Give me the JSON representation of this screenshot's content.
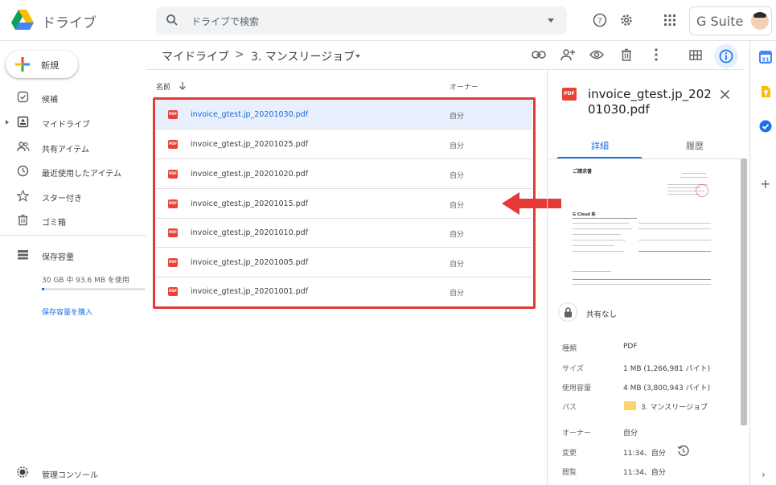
{
  "header": {
    "app_title": "ドライブ",
    "search_placeholder": "ドライブで検索",
    "gsuite_label": "G Suite"
  },
  "sidebar": {
    "new_label": "新規",
    "items": [
      {
        "label": "候補",
        "icon": "checkbox-icon"
      },
      {
        "label": "マイドライブ",
        "icon": "my-drive-icon"
      },
      {
        "label": "共有アイテム",
        "icon": "shared-icon"
      },
      {
        "label": "最近使用したアイテム",
        "icon": "clock-icon"
      },
      {
        "label": "スター付き",
        "icon": "star-icon"
      },
      {
        "label": "ゴミ箱",
        "icon": "trash-icon"
      }
    ],
    "storage": {
      "label": "保存容量",
      "usage": "30 GB 中 93.6 MB を使用",
      "fraction": 0.003,
      "buy_label": "保存容量を購入"
    },
    "admin_label": "管理コンソール"
  },
  "breadcrumb": {
    "root": "マイドライブ",
    "separator": ">",
    "current": "3. マンスリージョブ"
  },
  "file_list": {
    "col_name": "名前",
    "col_owner": "オーナー",
    "files": [
      {
        "name": "invoice_gtest.jp_20201030.pdf",
        "owner": "自分",
        "icon_text": "PDF"
      },
      {
        "name": "invoice_gtest.jp_20201025.pdf",
        "owner": "自分",
        "icon_text": "PDF"
      },
      {
        "name": "invoice_gtest.jp_20201020.pdf",
        "owner": "自分",
        "icon_text": "PDF"
      },
      {
        "name": "invoice_gtest.jp_20201015.pdf",
        "owner": "自分",
        "icon_text": "PDF"
      },
      {
        "name": "invoice_gtest.jp_20201010.pdf",
        "owner": "自分",
        "icon_text": "PDF"
      },
      {
        "name": "invoice_gtest.jp_20201005.pdf",
        "owner": "自分",
        "icon_text": "PDF"
      },
      {
        "name": "invoice_gtest.jp_20201001.pdf",
        "owner": "自分",
        "icon_text": "PDF"
      }
    ]
  },
  "details": {
    "icon_text": "PDF",
    "title": "invoice_gtest.jp_20201030.pdf",
    "tab_details": "詳細",
    "tab_activity": "履歴",
    "preview": {
      "heading": "ご請求書",
      "company": "G Cloud 株"
    },
    "sharing": "共有なし",
    "props": {
      "type_k": "種類",
      "type_v": "PDF",
      "size_k": "サイズ",
      "size_v": "1 MB (1,266,981 バイト)",
      "used_k": "使用容量",
      "used_v": "4 MB (3,800,943 バイト)",
      "path_k": "パス",
      "path_v": "3. マンスリージョブ",
      "owner_k": "オーナー",
      "owner_v": "自分",
      "modified_k": "変更",
      "modified_v": "11:34、自分",
      "viewed_k": "閲覧",
      "viewed_v": "11:34、自分"
    }
  },
  "colors": {
    "accent": "#1a73e8",
    "highlight": "#e53935",
    "pdf": "#ea4335"
  }
}
